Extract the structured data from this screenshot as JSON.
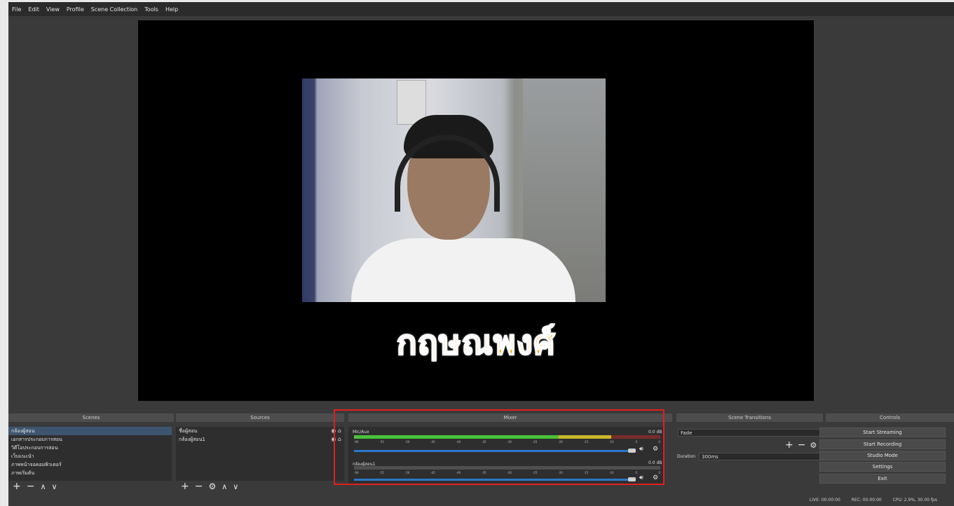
{
  "menu": [
    "File",
    "Edit",
    "View",
    "Profile",
    "Scene Collection",
    "Tools",
    "Help"
  ],
  "preview": {
    "caption": "กฤษณพงศ์"
  },
  "scenes": {
    "title": "Scenes",
    "items": [
      "กล้องผู้สอน",
      "เอกสารประกอบการสอน",
      "วิดีโอประกอบการสอน",
      "เว็บแนะนำ",
      "ภาพหน้าจอคอมพิวเตอร์",
      "ภาพเริ่มต้น"
    ],
    "selected_index": 0
  },
  "sources": {
    "title": "Sources",
    "items": [
      "ชื่อผู้สอน",
      "กล้องผู้สอน1"
    ]
  },
  "mixer": {
    "title": "Mixer",
    "channels": [
      {
        "name": "Mic/Aux",
        "db": "0.0 dB",
        "level": 0.85,
        "volume": 1.0
      },
      {
        "name": "กล้องผู้สอน1",
        "db": "0.0 dB",
        "level": 0.0,
        "volume": 1.0
      }
    ],
    "ticks": [
      "-60",
      "-55",
      "-50",
      "-45",
      "-40",
      "-35",
      "-30",
      "-25",
      "-20",
      "-15",
      "-10",
      "-5",
      "0"
    ]
  },
  "transitions": {
    "title": "Scene Transitions",
    "selected": "Fade",
    "duration_label": "Duration",
    "duration_value": "300ms"
  },
  "controls": {
    "title": "Controls",
    "buttons": [
      "Start Streaming",
      "Start Recording",
      "Studio Mode",
      "Settings",
      "Exit"
    ]
  },
  "status": {
    "live": "LIVE: 00:00:00",
    "rec": "REC: 00:00:00",
    "cpu": "CPU: 2.9%, 30.00 fps"
  },
  "colors": {
    "accent_highlight": "#e21f1f",
    "meter_green": "#4ac33a",
    "volume_blue": "#2b78c9",
    "caption": "#f7a31a"
  }
}
